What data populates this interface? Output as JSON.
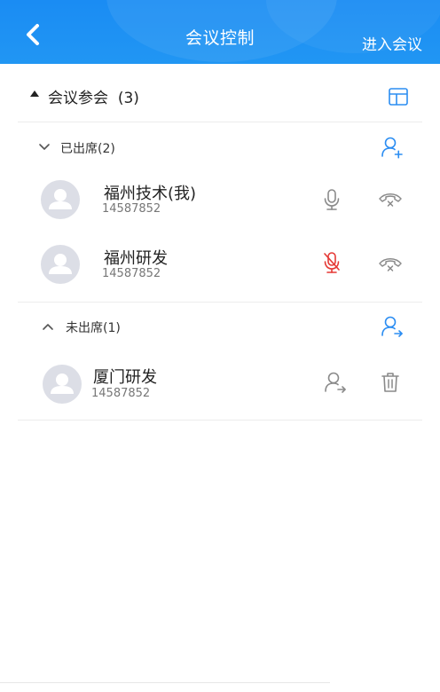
{
  "header": {
    "title": "会议控制",
    "enter_label": "进入会议",
    "color": "#1a8cf3"
  },
  "section": {
    "title": "会议参会",
    "count": "(3)"
  },
  "attended": {
    "label": "已出席(2)",
    "members": [
      {
        "name": "福州技术(我)",
        "number": "14587852",
        "mic": "on"
      },
      {
        "name": "福州研发",
        "number": "14587852",
        "mic": "muted"
      }
    ]
  },
  "absent": {
    "label": "未出席(1)",
    "members": [
      {
        "name": "厦门研发",
        "number": "14587852"
      }
    ]
  },
  "colors": {
    "accent": "#2b8df2",
    "muted_red": "#e53935",
    "icon_gray": "#8a8a8a"
  }
}
